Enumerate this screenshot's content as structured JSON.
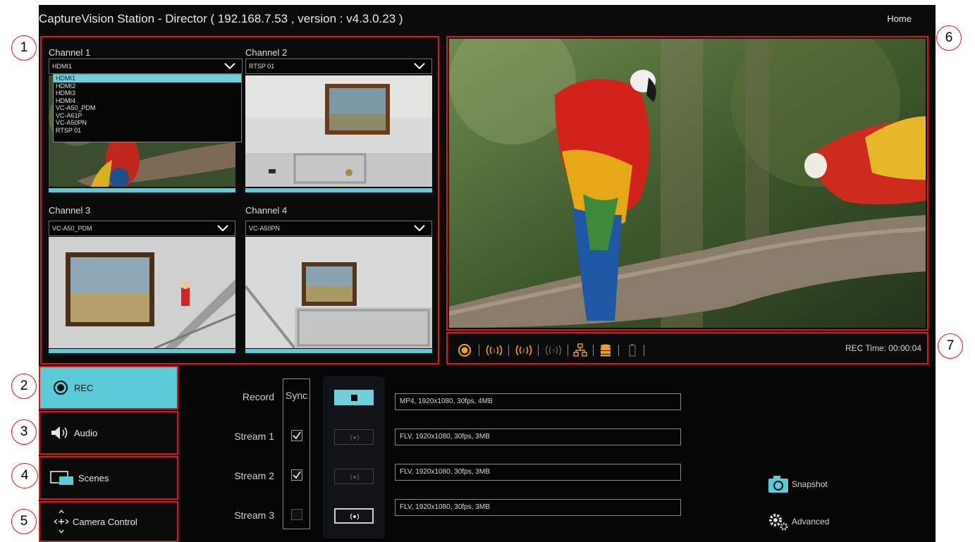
{
  "window": {
    "title": "CaptureVision Station - Director ( 192.168.7.53 , version : v4.3.0.23 )",
    "home_label": "Home"
  },
  "channels": [
    {
      "label": "Channel 1",
      "selected": "HDMI1",
      "dropdown_open": true
    },
    {
      "label": "Channel 2",
      "selected": "RTSP 01",
      "dropdown_open": false
    },
    {
      "label": "Channel 3",
      "selected": "VC-A50_PDM",
      "dropdown_open": false
    },
    {
      "label": "Channel 4",
      "selected": "VC-A50PN",
      "dropdown_open": false
    }
  ],
  "channel1_options": [
    "HDMI1",
    "HDMI2",
    "HDMI3",
    "HDMI4",
    "VC-A50_PDM",
    "VC-A61P",
    "VC-A50PN",
    "RTSP 01"
  ],
  "toolbar": {
    "rec_time": "REC Time: 00:00:04",
    "icons": [
      "record-icon",
      "stream1-icon",
      "stream2-icon",
      "stream3-icon",
      "network-icon",
      "storage-icon",
      "battery-icon"
    ],
    "accent": "#f0a020"
  },
  "menu": {
    "rec": "REC",
    "audio": "Audio",
    "scenes": "Scenes",
    "camera_control": "Camera Control"
  },
  "rec_panel": {
    "sync_header": "Sync",
    "rows": [
      {
        "label": "Record",
        "info": "MP4, 1920x1080, 30fps, 4MB",
        "sync": null
      },
      {
        "label": "Stream 1",
        "info": "FLV, 1920x1080, 30fps, 3MB",
        "sync": true
      },
      {
        "label": "Stream 2",
        "info": "FLV, 1920x1080, 30fps, 3MB",
        "sync": true
      },
      {
        "label": "Stream 3",
        "info": "FLV, 1920x1080, 30fps, 3MB",
        "sync": false
      }
    ]
  },
  "actions": {
    "snapshot": "Snapshot",
    "advanced": "Advanced"
  },
  "callouts": [
    "1",
    "2",
    "3",
    "4",
    "5",
    "6",
    "7"
  ],
  "colors": {
    "accent_cyan": "#5ccbd8",
    "highlight_red": "#e01414",
    "rec_orange": "#f0a020"
  }
}
